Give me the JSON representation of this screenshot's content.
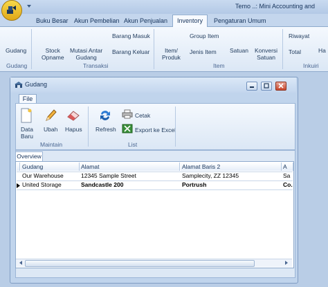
{
  "window": {
    "title": "Temo ..: Mini Accounting and"
  },
  "tabs": [
    "Buku Besar",
    "Akun Pembelian",
    "Akun Penjualan",
    "Inventory",
    "Pengaturan Umum"
  ],
  "ribbon": {
    "gudang": "Gudang",
    "stock_opname_1": "Stock",
    "stock_opname_2": "Opname",
    "mutasi_1": "Mutasi Antar",
    "mutasi_2": "Gudang",
    "barang_masuk": "Barang Masuk",
    "barang_keluar": "Barang Keluar",
    "item_produk_1": "Item/",
    "item_produk_2": "Produk",
    "group_item": "Group Item",
    "jenis_item": "Jenis Item",
    "satuan": "Satuan",
    "konversi_1": "Konversi",
    "konversi_2": "Satuan",
    "riwayat": "Riwayat",
    "total": "Total",
    "ha": "Ha",
    "groups": {
      "gudang": "Gudang",
      "transaksi": "Transaksi",
      "item": "Item",
      "inkuiri": "Inkuiri"
    }
  },
  "child": {
    "title": "Gudang",
    "file_tab": "File",
    "buttons": {
      "data_baru_1": "Data",
      "data_baru_2": "Baru",
      "ubah": "Ubah",
      "hapus": "Hapus",
      "refresh": "Refresh",
      "cetak": "Cetak",
      "export_excel": "Export ke Excel"
    },
    "groups": {
      "maintain": "Maintain",
      "list": "List"
    },
    "overview_tab": "Overview"
  },
  "grid": {
    "columns": [
      "Gudang",
      "Alamat",
      "Alamat Baris 2",
      "A"
    ],
    "rows": [
      [
        "Our Warehouse",
        "12345 Sample Street",
        "Samplecity, ZZ 12345",
        "Sa"
      ],
      [
        "United Storage",
        "Sandcastle 200",
        "Portrush",
        "Co."
      ]
    ]
  },
  "colors": {
    "accent": "#1e395b",
    "ribbon_bg": "#dbe7f5",
    "frame": "#b9cde6"
  }
}
